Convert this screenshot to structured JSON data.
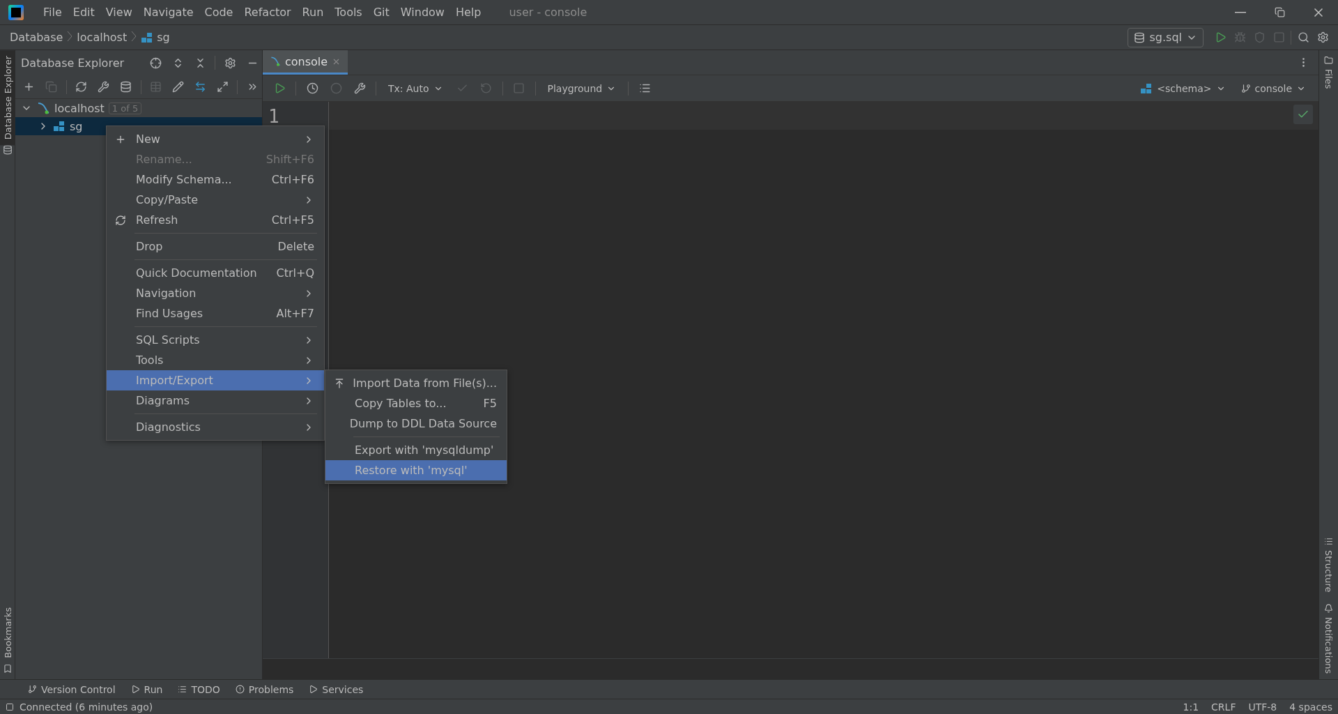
{
  "window": {
    "title": "user - console",
    "menu": [
      "File",
      "Edit",
      "View",
      "Navigate",
      "Code",
      "Refactor",
      "Run",
      "Tools",
      "Git",
      "Window",
      "Help"
    ]
  },
  "breadcrumbs": [
    {
      "label": "Database",
      "kind": "text"
    },
    {
      "label": "localhost",
      "kind": "text"
    },
    {
      "label": "sg",
      "kind": "schema"
    }
  ],
  "run_config": {
    "label": "sg.sql"
  },
  "left_strip": {
    "top": [
      {
        "label": "Database Explorer",
        "selected": true
      }
    ],
    "bottom": [
      {
        "label": "Bookmarks",
        "selected": false
      }
    ]
  },
  "right_strip": {
    "top": [
      {
        "label": "Files"
      }
    ],
    "bottom": [
      {
        "label": "Structure"
      },
      {
        "label": "Notifications"
      }
    ]
  },
  "explorer": {
    "title": "Database Explorer",
    "tree": [
      {
        "label": "localhost",
        "badge": "1 of 5",
        "kind": "server",
        "expanded": true,
        "selected": false,
        "children": [
          {
            "label": "sg",
            "kind": "schema",
            "expanded": false,
            "selected": true
          }
        ]
      }
    ]
  },
  "editor": {
    "tabs": [
      {
        "label": "console",
        "selected": true
      }
    ],
    "tx_mode": "Tx: Auto",
    "run_mode": "Playground",
    "schema": "<schema>",
    "session": "console",
    "line_numbers": [
      "1"
    ]
  },
  "context_menu": {
    "groups": [
      [
        {
          "label": "New",
          "submenu": true,
          "disabled": false,
          "selected": false
        },
        {
          "label": "Rename...",
          "shortcut": "Shift+F6",
          "submenu": false,
          "disabled": true,
          "selected": false
        },
        {
          "label": "Modify Schema...",
          "shortcut": "Ctrl+F6",
          "submenu": false,
          "disabled": false,
          "selected": false
        },
        {
          "label": "Copy/Paste",
          "submenu": true,
          "disabled": false,
          "selected": false
        },
        {
          "label": "Refresh",
          "shortcut": "Ctrl+F5",
          "submenu": false,
          "disabled": false,
          "selected": false
        }
      ],
      [
        {
          "label": "Drop",
          "shortcut": "Delete",
          "submenu": false,
          "disabled": false,
          "selected": false
        }
      ],
      [
        {
          "label": "Quick Documentation",
          "shortcut": "Ctrl+Q",
          "submenu": false,
          "disabled": false,
          "selected": false
        },
        {
          "label": "Navigation",
          "submenu": true,
          "disabled": false,
          "selected": false
        },
        {
          "label": "Find Usages",
          "shortcut": "Alt+F7",
          "submenu": false,
          "disabled": false,
          "selected": false
        }
      ],
      [
        {
          "label": "SQL Scripts",
          "submenu": true,
          "disabled": false,
          "selected": false
        },
        {
          "label": "Tools",
          "submenu": true,
          "disabled": false,
          "selected": false
        },
        {
          "label": "Import/Export",
          "submenu": true,
          "disabled": false,
          "selected": true
        },
        {
          "label": "Diagrams",
          "submenu": true,
          "disabled": false,
          "selected": false
        }
      ],
      [
        {
          "label": "Diagnostics",
          "submenu": true,
          "disabled": false,
          "selected": false
        }
      ]
    ]
  },
  "submenu": {
    "groups": [
      [
        {
          "label": "Import Data from File(s)...",
          "submenu": false,
          "disabled": false,
          "selected": false
        },
        {
          "label": "Copy Tables to...",
          "shortcut": "F5",
          "submenu": false,
          "disabled": false,
          "selected": false
        },
        {
          "label": "Dump to DDL Data Source",
          "submenu": false,
          "disabled": false,
          "selected": false
        }
      ],
      [
        {
          "label": "Export with 'mysqldump'",
          "submenu": false,
          "disabled": false,
          "selected": false
        },
        {
          "label": "Restore with 'mysql'",
          "submenu": false,
          "disabled": false,
          "selected": true
        }
      ]
    ]
  },
  "bottom_tools": [
    "Version Control",
    "Run",
    "TODO",
    "Problems",
    "Services"
  ],
  "status_bar": {
    "message": "Connected (6 minutes ago)",
    "items": [
      "1:1",
      "CRLF",
      "UTF-8",
      "4 spaces"
    ]
  }
}
